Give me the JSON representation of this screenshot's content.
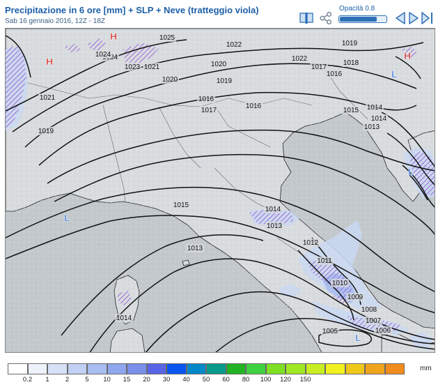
{
  "header": {
    "title": "Precipitazione in 6 ore [mm] + SLP + Neve (tratteggio viola)",
    "subtitle": "Sab 16 gennaio 2016, 12Z - 18Z"
  },
  "toolbar": {
    "opacity_label": "Opacità 0.8",
    "opacity_value": 0.8,
    "icons": [
      "book-icon",
      "share-icon",
      "play-back-icon",
      "play-icon",
      "play-forward-icon"
    ]
  },
  "map": {
    "isobar_labels": [
      "1025",
      "1022",
      "1024",
      "1022",
      "1023",
      "1021",
      "1020",
      "1020",
      "1019",
      "1019",
      "1018",
      "1017",
      "1017",
      "1016",
      "1016",
      "1016",
      "1015",
      "1015",
      "1014",
      "1014",
      "1014",
      "1013",
      "1013",
      "1012",
      "1011",
      "1010",
      "1009",
      "1008",
      "1007",
      "1006",
      "1005",
      "1019",
      "1021",
      "1018",
      "1024",
      "1014",
      "1013"
    ],
    "pressure_centers": [
      "H",
      "H",
      "H",
      "L",
      "L",
      "L",
      "L"
    ],
    "colors": {
      "land": "#d9dcdf",
      "sea": "#c3c8cc",
      "isobar": "#111111",
      "snow_hatch": "#9b6bd6",
      "precip_light": "#c9d8f2",
      "precip_mid": "#a9bdf0",
      "high": "#d11d1d",
      "low": "#2e6fd4"
    }
  },
  "legend": {
    "unit": "mm",
    "colors": [
      "#ffffff",
      "#eef2fb",
      "#d6e0f7",
      "#c1d0f4",
      "#a8bdf1",
      "#8fa7ee",
      "#7b90ea",
      "#5a64e6",
      "#0a55f0",
      "#0588c8",
      "#0a9a8a",
      "#21b321",
      "#3fd23f",
      "#7fdf23",
      "#9fe823",
      "#c8ee23",
      "#f1f120",
      "#f0c81a",
      "#f0a41e",
      "#f08c1e"
    ],
    "ticks": [
      "0.2",
      "1",
      "2",
      "5",
      "10",
      "15",
      "20",
      "30",
      "40",
      "50",
      "60",
      "80",
      "100",
      "120",
      "150"
    ]
  }
}
